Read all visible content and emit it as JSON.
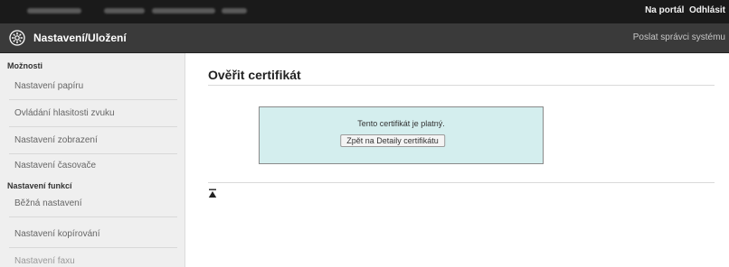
{
  "topbar": {
    "portal_link": "Na portál",
    "logout_link": "Odhlásit"
  },
  "header": {
    "title": "Nastavení/Uložení",
    "admin_link": "Poslat správci systému"
  },
  "sidebar": {
    "sections": [
      {
        "title": "Možnosti",
        "items": [
          "Nastavení papíru",
          "Ovládání hlasitosti zvuku",
          "Nastavení zobrazení",
          "Nastavení časovače"
        ]
      },
      {
        "title": "Nastavení funkcí",
        "items": [
          "Běžná nastavení",
          "Nastavení kopírování",
          "Nastavení faxu"
        ]
      }
    ]
  },
  "main": {
    "title": "Ověřit certifikát",
    "message": "Tento certifikát je platný.",
    "back_button": "Zpět na Detaily certifikátu"
  },
  "colors": {
    "topbar": "#1a1a1a",
    "header": "#3a3a3a",
    "sidebar": "#efefef",
    "result_box": "#d4eeee"
  },
  "icons": {
    "header": "gear-icon",
    "scroll_top": "scroll-top-icon"
  }
}
